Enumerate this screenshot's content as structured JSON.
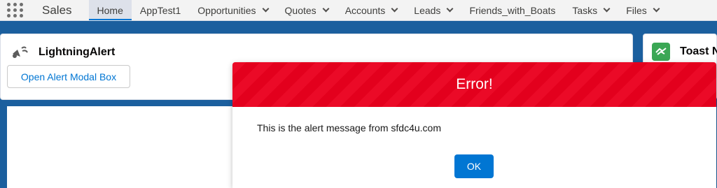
{
  "app": {
    "name": "Sales"
  },
  "nav": {
    "items": [
      {
        "label": "Home",
        "has_menu": false,
        "active": true
      },
      {
        "label": "AppTest1",
        "has_menu": false
      },
      {
        "label": "Opportunities",
        "has_menu": true
      },
      {
        "label": "Quotes",
        "has_menu": true
      },
      {
        "label": "Accounts",
        "has_menu": true
      },
      {
        "label": "Leads",
        "has_menu": true
      },
      {
        "label": "Friends_with_Boats",
        "has_menu": false
      },
      {
        "label": "Tasks",
        "has_menu": true
      },
      {
        "label": "Files",
        "has_menu": true
      }
    ]
  },
  "lightning_card": {
    "title": "LightningAlert",
    "button_label": "Open Alert Modal Box"
  },
  "toast_card": {
    "title": "Toast N"
  },
  "modal": {
    "title": "Error!",
    "message": "This is the alert message from sfdc4u.com",
    "ok_label": "OK"
  },
  "colors": {
    "modal_header": "#ea001e",
    "brand_blue": "#0176d3",
    "toast_icon": "#3ba755"
  },
  "icons": {
    "app_launcher": "waffle-icon",
    "card": "notification-bell-icon",
    "toast": "toast-icon"
  }
}
